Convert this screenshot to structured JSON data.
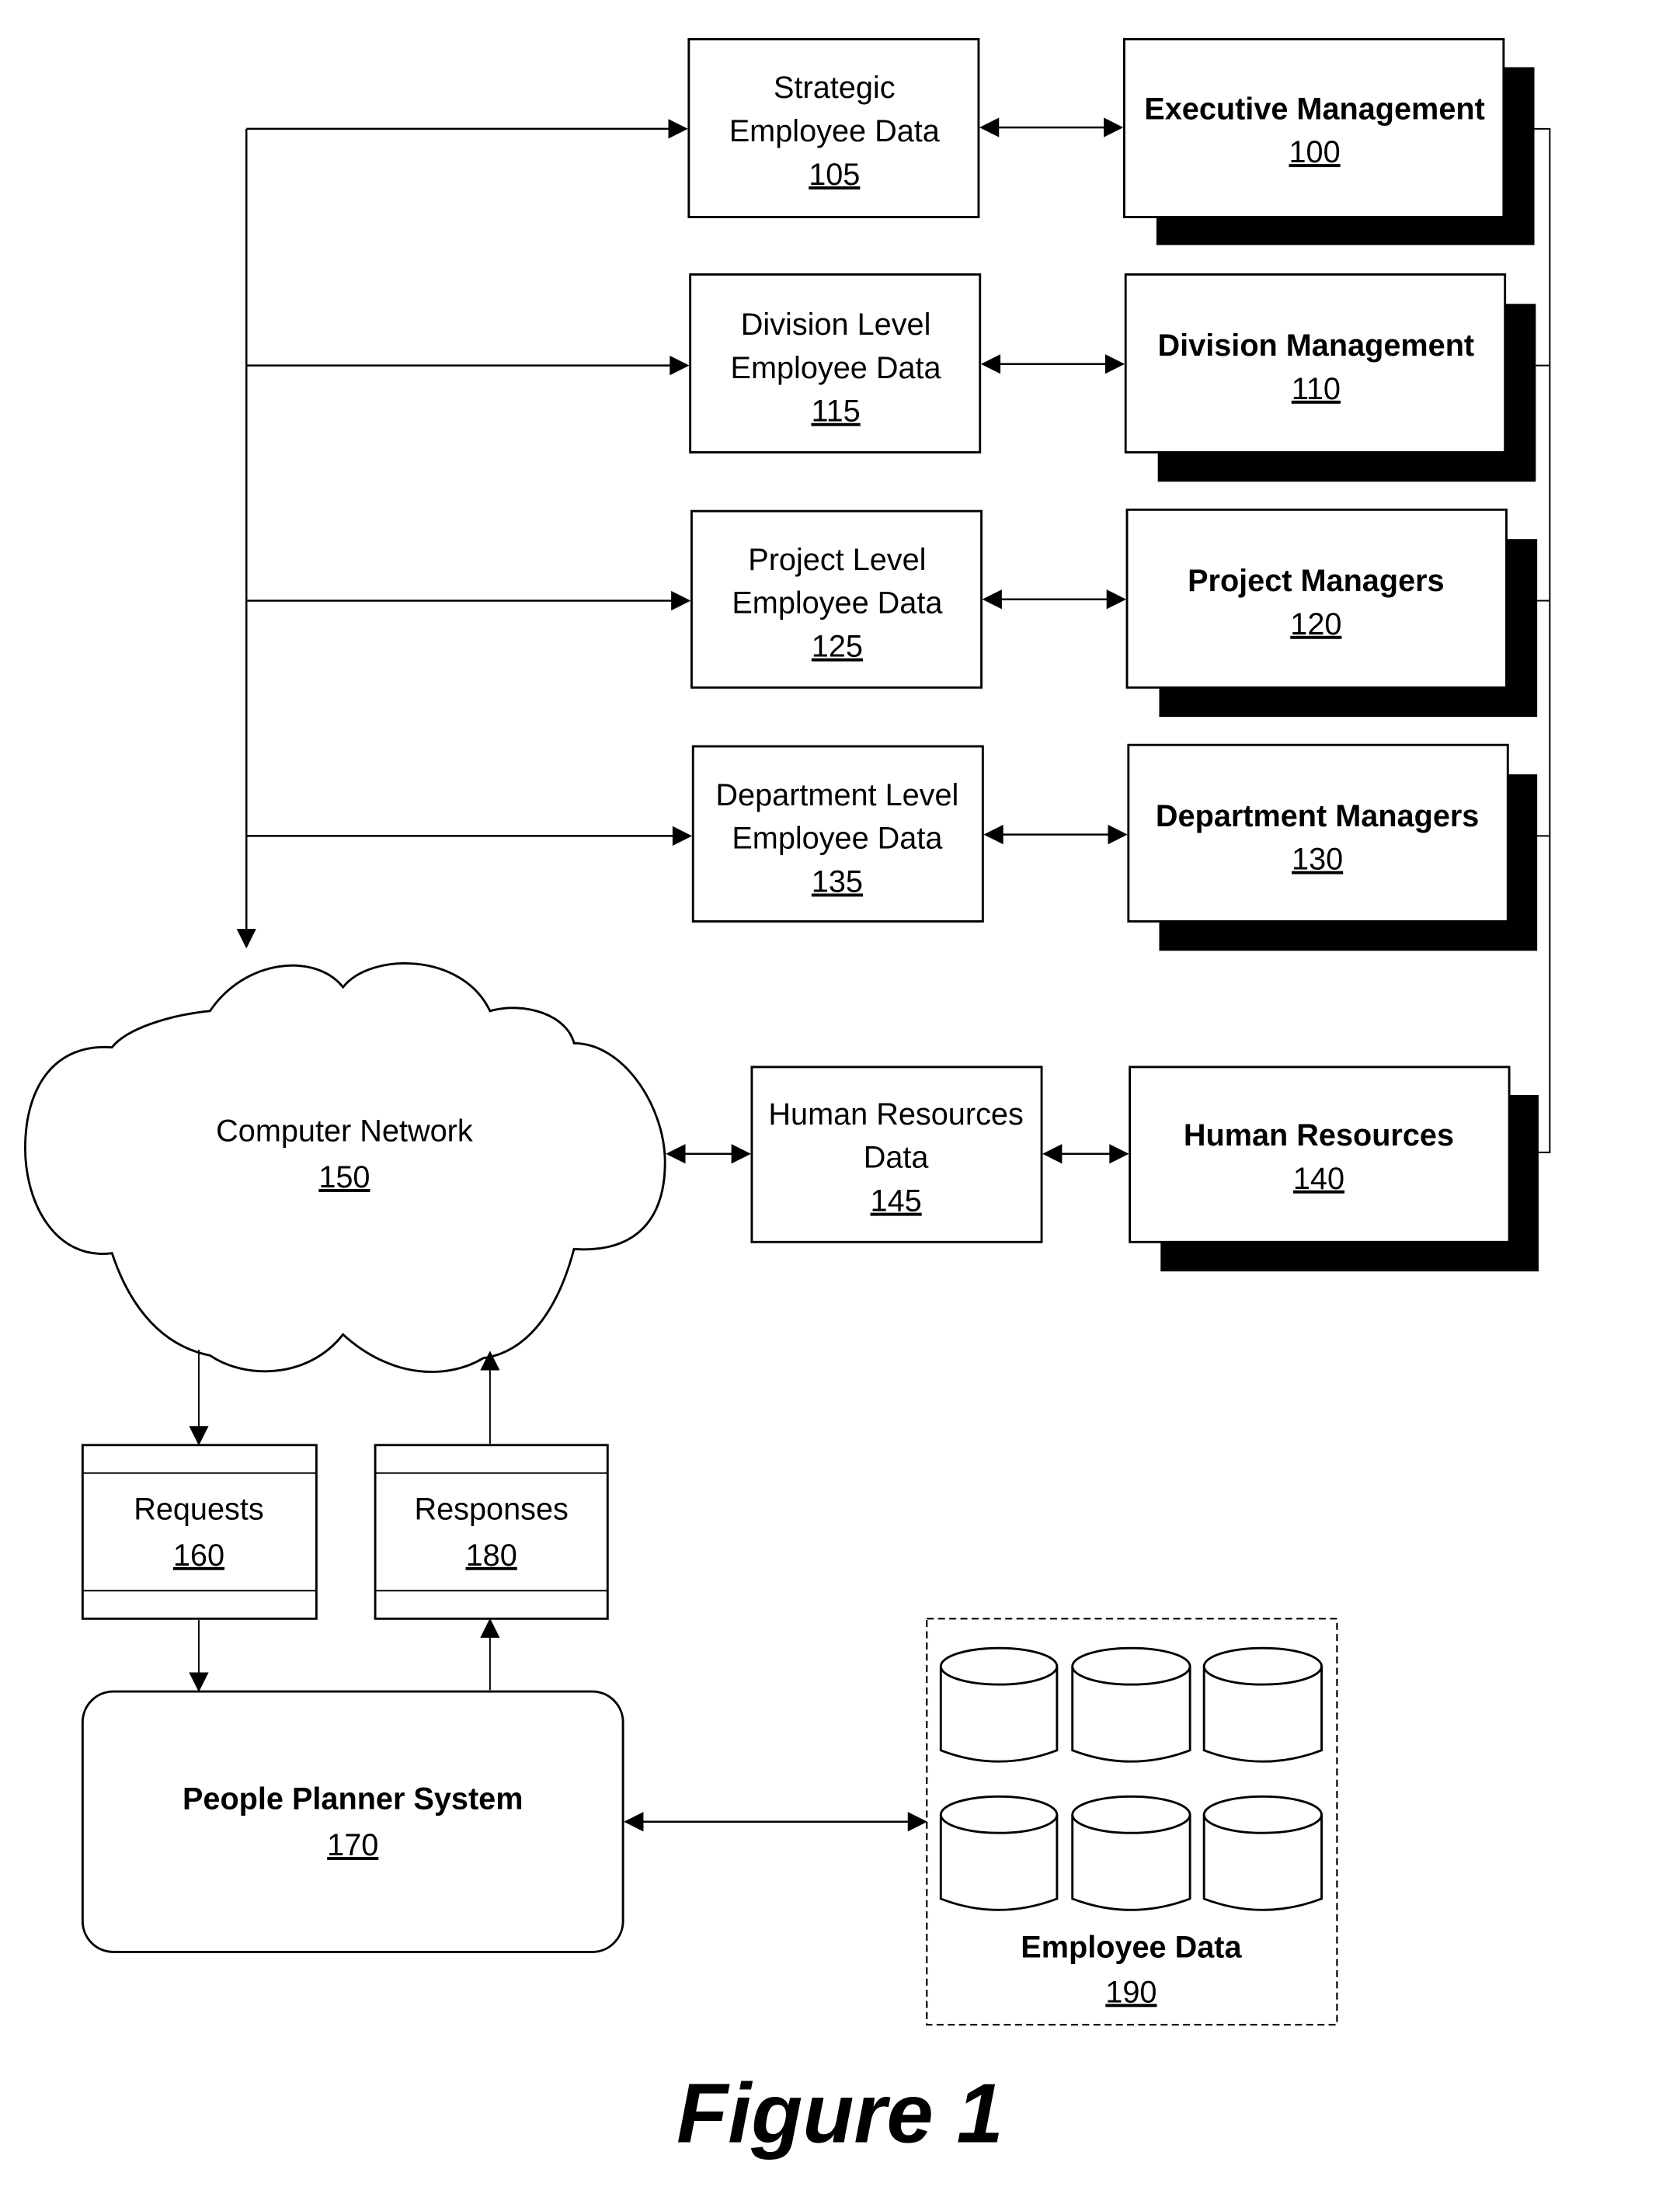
{
  "figure_label": "Figure 1",
  "data_boxes": [
    {
      "lines": [
        "Strategic",
        "Employee Data"
      ],
      "ref": "105"
    },
    {
      "lines": [
        "Division Level",
        "Employee Data"
      ],
      "ref": "115"
    },
    {
      "lines": [
        "Project Level",
        "Employee Data"
      ],
      "ref": "125"
    },
    {
      "lines": [
        "Department Level",
        "Employee Data"
      ],
      "ref": "135"
    },
    {
      "lines": [
        "Human Resources",
        "Data"
      ],
      "ref": "145"
    }
  ],
  "role_boxes": [
    {
      "label": "Executive Management",
      "ref": "100"
    },
    {
      "label": "Division Management",
      "ref": "110"
    },
    {
      "label": "Project Managers",
      "ref": "120"
    },
    {
      "label": "Department Managers",
      "ref": "130"
    },
    {
      "label": "Human Resources",
      "ref": "140"
    }
  ],
  "network": {
    "label": "Computer Network",
    "ref": "150"
  },
  "requests": {
    "label": "Requests",
    "ref": "160"
  },
  "responses": {
    "label": "Responses",
    "ref": "180"
  },
  "system": {
    "label": "People Planner System",
    "ref": "170"
  },
  "employee_data": {
    "label": "Employee Data",
    "ref": "190"
  }
}
